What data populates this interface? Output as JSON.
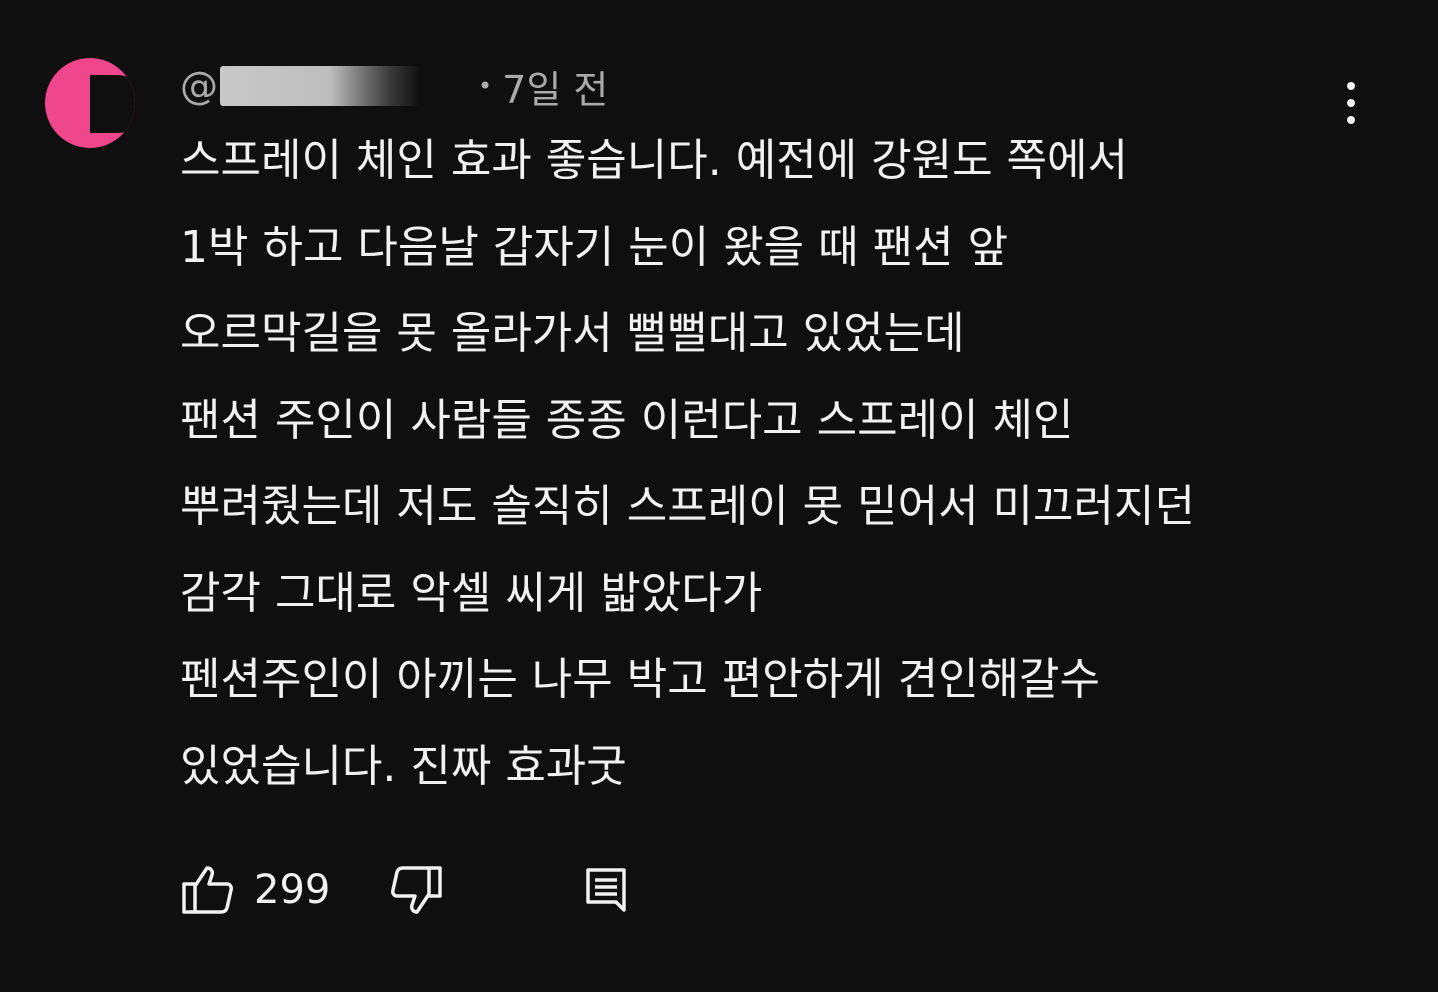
{
  "comment": {
    "author_prefix": "@",
    "timestamp_dot": "•",
    "timestamp": "7일 전",
    "avatar_color": "#f0468b",
    "lines": [
      "스프레이 체인  효과 좋습니다. 예전에 강원도 쪽에서",
      "1박 하고 다음날 갑자기 눈이 왔을 때 팬션 앞",
      "오르막길을 못 올라가서 뻘뻘대고 있었는데",
      "팬션 주인이 사람들 종종 이런다고 스프레이 체인",
      "뿌려줬는데 저도 솔직히 스프레이 못 믿어서 미끄러지던",
      "감각 그대로 악셀 씨게 밟았다가",
      "펜션주인이 아끼는 나무 박고 편안하게 견인해갈수",
      "있었습니다. 진짜 효과굿"
    ],
    "like_count": "299",
    "icons": {
      "menu": "more-vert-icon",
      "like": "thumb-up-icon",
      "dislike": "thumb-down-icon",
      "reply": "reply-comment-icon"
    }
  }
}
